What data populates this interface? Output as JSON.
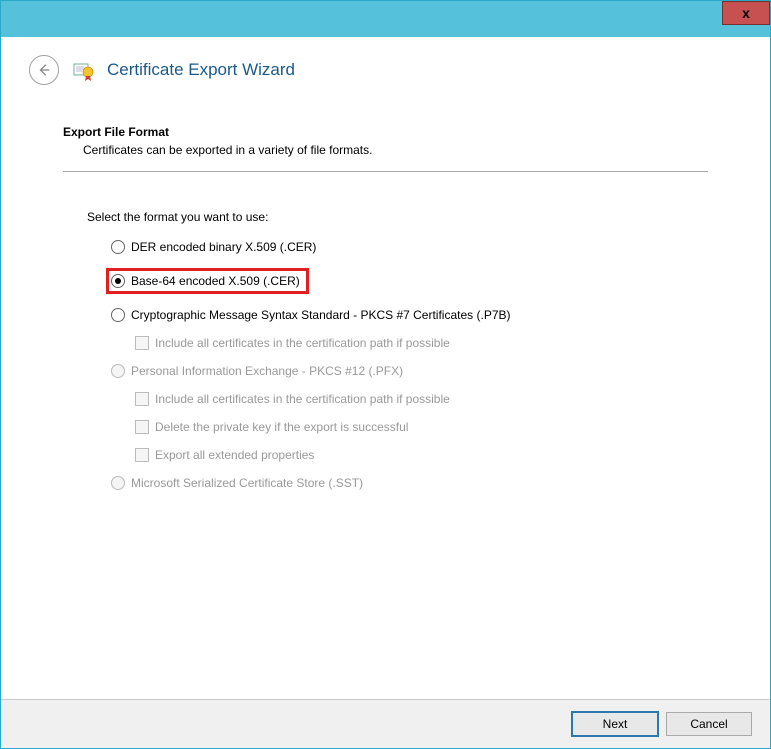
{
  "window": {
    "close": "x"
  },
  "header": {
    "title": "Certificate Export Wizard"
  },
  "section": {
    "heading": "Export File Format",
    "description": "Certificates can be exported in a variety of file formats."
  },
  "instruction": "Select the format you want to use:",
  "options": {
    "der": "DER encoded binary X.509 (.CER)",
    "base64": "Base-64 encoded X.509 (.CER)",
    "pkcs7": "Cryptographic Message Syntax Standard - PKCS #7 Certificates (.P7B)",
    "pkcs7_include": "Include all certificates in the certification path if possible",
    "pfx": "Personal Information Exchange - PKCS #12 (.PFX)",
    "pfx_include": "Include all certificates in the certification path if possible",
    "pfx_delete": "Delete the private key if the export is successful",
    "pfx_export": "Export all extended properties",
    "sst": "Microsoft Serialized Certificate Store (.SST)"
  },
  "buttons": {
    "next": "Next",
    "cancel": "Cancel"
  }
}
